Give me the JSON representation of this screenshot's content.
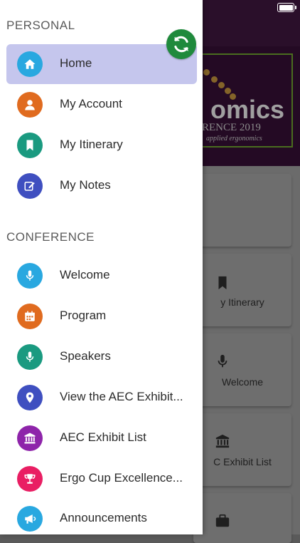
{
  "drawer": {
    "personal_section": {
      "title": "PERSONAL",
      "items": [
        {
          "label": "Home",
          "icon": "home-icon",
          "color": "#29a8e0",
          "active": true
        },
        {
          "label": "My Account",
          "icon": "user-icon",
          "color": "#e06b1f"
        },
        {
          "label": "My Itinerary",
          "icon": "bookmark-icon",
          "color": "#1a9a80"
        },
        {
          "label": "My Notes",
          "icon": "edit-icon",
          "color": "#3f4fc0"
        }
      ]
    },
    "conference_section": {
      "title": "CONFERENCE",
      "items": [
        {
          "label": "Welcome",
          "icon": "microphone-icon",
          "color": "#29a8e0"
        },
        {
          "label": "Program",
          "icon": "calendar-icon",
          "color": "#e06b1f"
        },
        {
          "label": "Speakers",
          "icon": "microphone-icon",
          "color": "#1a9a80"
        },
        {
          "label": "View the AEC Exhibit...",
          "icon": "map-marker-icon",
          "color": "#3f4fc0"
        },
        {
          "label": "AEC Exhibit List",
          "icon": "bank-icon",
          "color": "#8e24aa"
        },
        {
          "label": "Ergo Cup Excellence...",
          "icon": "trophy-icon",
          "color": "#e91e63"
        },
        {
          "label": "Announcements",
          "icon": "megaphone-icon",
          "color": "#29a8e0"
        }
      ]
    },
    "sync_button": {
      "icon": "refresh-icon",
      "color": "#1f8a3c"
    }
  },
  "background": {
    "banner": {
      "title": "omics",
      "subtitle": "RENCE 2019",
      "tagline": "applied ergonomics"
    },
    "tiles": [
      {
        "label": "y Itinerary",
        "icon": "bookmark-icon"
      },
      {
        "label": "Welcome",
        "icon": "microphone-icon"
      },
      {
        "label": "C Exhibit List",
        "icon": "bank-icon"
      },
      {
        "label": "",
        "icon": "briefcase-icon"
      }
    ]
  },
  "status_bar": {
    "battery_icon": "battery-icon"
  }
}
